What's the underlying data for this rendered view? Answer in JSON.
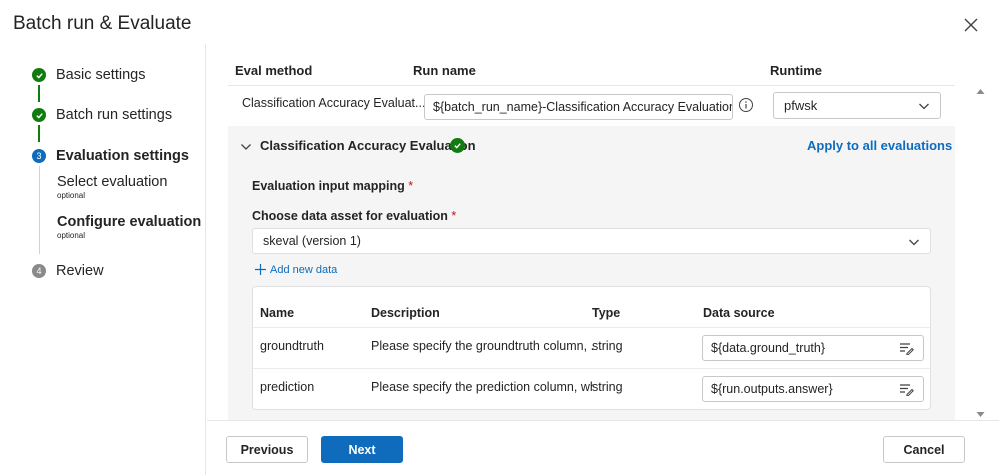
{
  "dialog": {
    "title": "Batch run & Evaluate"
  },
  "sidebar": {
    "steps": [
      {
        "label": "Basic settings",
        "state": "done"
      },
      {
        "label": "Batch run settings",
        "state": "done"
      },
      {
        "label": "Evaluation settings",
        "state": "current",
        "number": "3"
      },
      {
        "label": "Review",
        "state": "future",
        "number": "4"
      }
    ],
    "sub_steps": [
      {
        "label": "Select evaluation",
        "hint": "optional"
      },
      {
        "label": "Configure evaluation",
        "hint": "optional"
      }
    ]
  },
  "run_table": {
    "headers": {
      "eval_method": "Eval method",
      "run_name": "Run name",
      "runtime": "Runtime"
    },
    "row": {
      "eval_method": "Classification Accuracy Evaluat...",
      "run_name": "${batch_run_name}-Classification Accuracy Evaluation-$",
      "runtime": "pfwsk"
    }
  },
  "eval_panel": {
    "title": "Classification Accuracy Evaluation",
    "apply_link": "Apply to all evaluations",
    "mapping_label": "Evaluation input mapping",
    "choose_label": "Choose data asset for evaluation",
    "required_mark": "*",
    "asset_value": "skeval (version 1)",
    "add_data": "Add new data"
  },
  "mapping_table": {
    "headers": {
      "name": "Name",
      "description": "Description",
      "type": "Type",
      "source": "Data source"
    },
    "rows": [
      {
        "name": "groundtruth",
        "description": "Please specify the groundtruth column, ...",
        "type": "string",
        "source": "${data.ground_truth}"
      },
      {
        "name": "prediction",
        "description": "Please specify the prediction column, wh...",
        "type": "string",
        "source": "${run.outputs.answer}"
      }
    ]
  },
  "footer": {
    "previous": "Previous",
    "next": "Next",
    "cancel": "Cancel"
  },
  "colors": {
    "accent": "#0f6cbd",
    "success": "#107c10",
    "required": "#c50f1f"
  }
}
